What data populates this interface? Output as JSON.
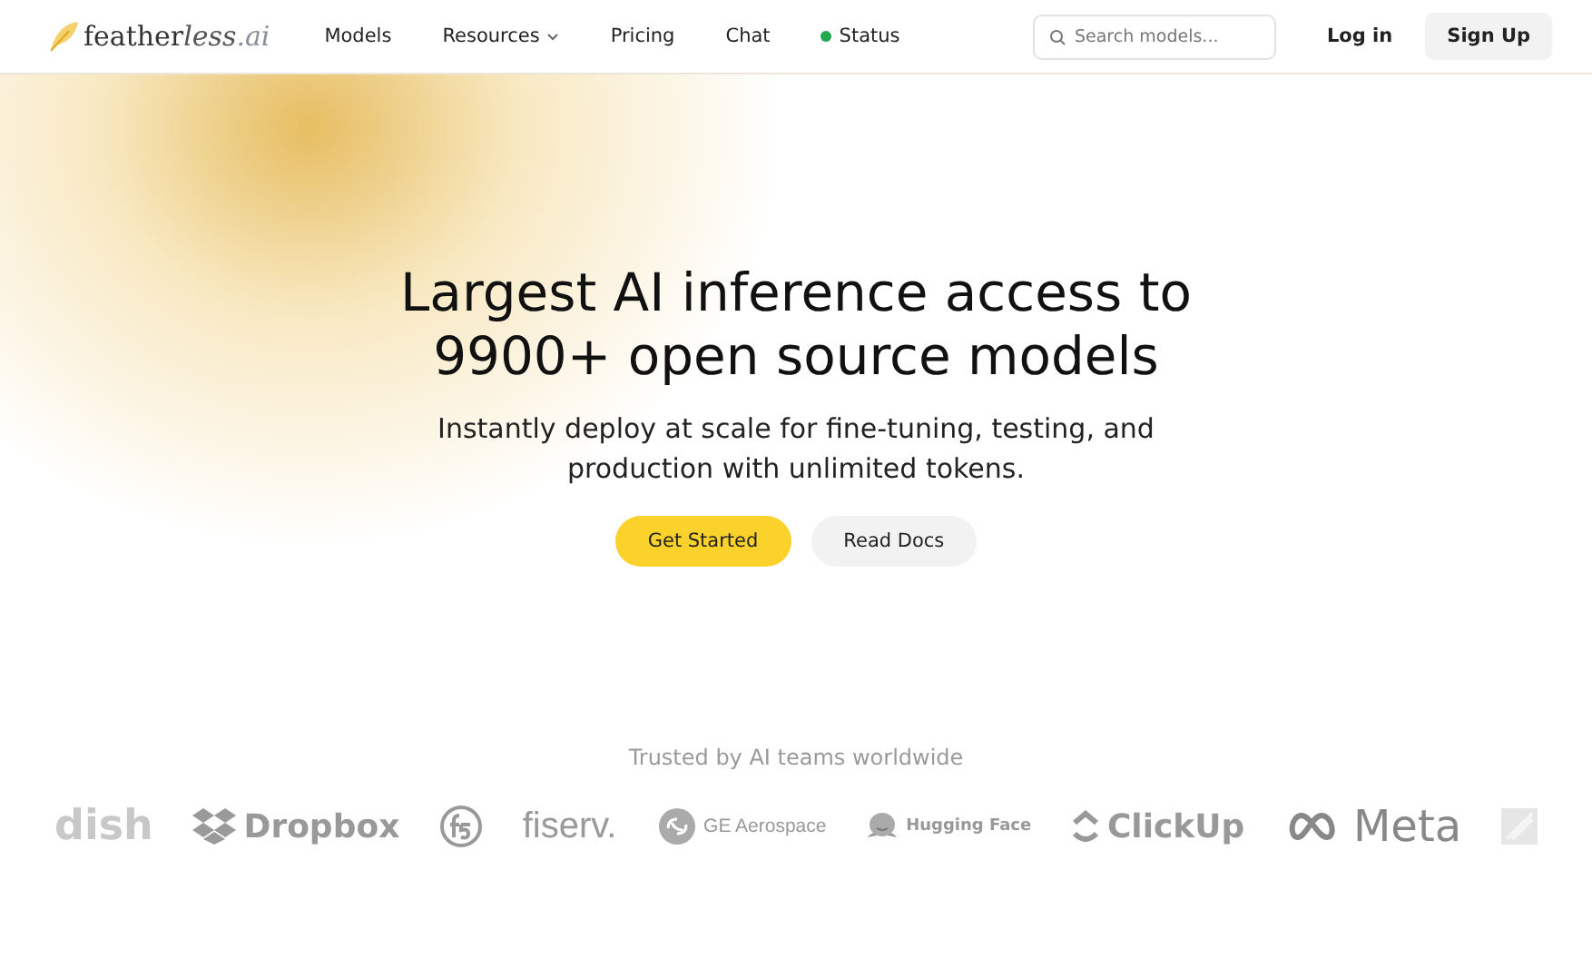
{
  "brand": {
    "name": "feather",
    "suffix": "less",
    "tld": ".ai"
  },
  "nav": [
    {
      "label": "Models",
      "kind": "link"
    },
    {
      "label": "Resources",
      "kind": "dropdown"
    },
    {
      "label": "Pricing",
      "kind": "link"
    },
    {
      "label": "Chat",
      "kind": "link"
    },
    {
      "label": "Status",
      "kind": "status",
      "color": "#22a94f"
    }
  ],
  "search": {
    "placeholder": "Search models..."
  },
  "auth": {
    "login": "Log in",
    "signup": "Sign Up"
  },
  "hero": {
    "title": "Largest AI inference access to 9900+ open source models",
    "subtitle": "Instantly deploy at scale for fine-tuning, testing, and production with unlimited tokens.",
    "primary": "Get Started",
    "secondary": "Read Docs"
  },
  "trusted": {
    "caption": "Trusted by AI teams worldwide",
    "logos": [
      {
        "kind": "dish",
        "label": "dish"
      },
      {
        "kind": "dropbox",
        "label": "Dropbox"
      },
      {
        "kind": "f5"
      },
      {
        "kind": "fiserv",
        "label": "fiserv."
      },
      {
        "kind": "ge",
        "label": "GE Aerospace"
      },
      {
        "kind": "hugging",
        "label": "Hugging Face"
      },
      {
        "kind": "clickup",
        "label": "ClickUp"
      },
      {
        "kind": "meta",
        "label": "Meta"
      },
      {
        "kind": "square"
      }
    ]
  }
}
